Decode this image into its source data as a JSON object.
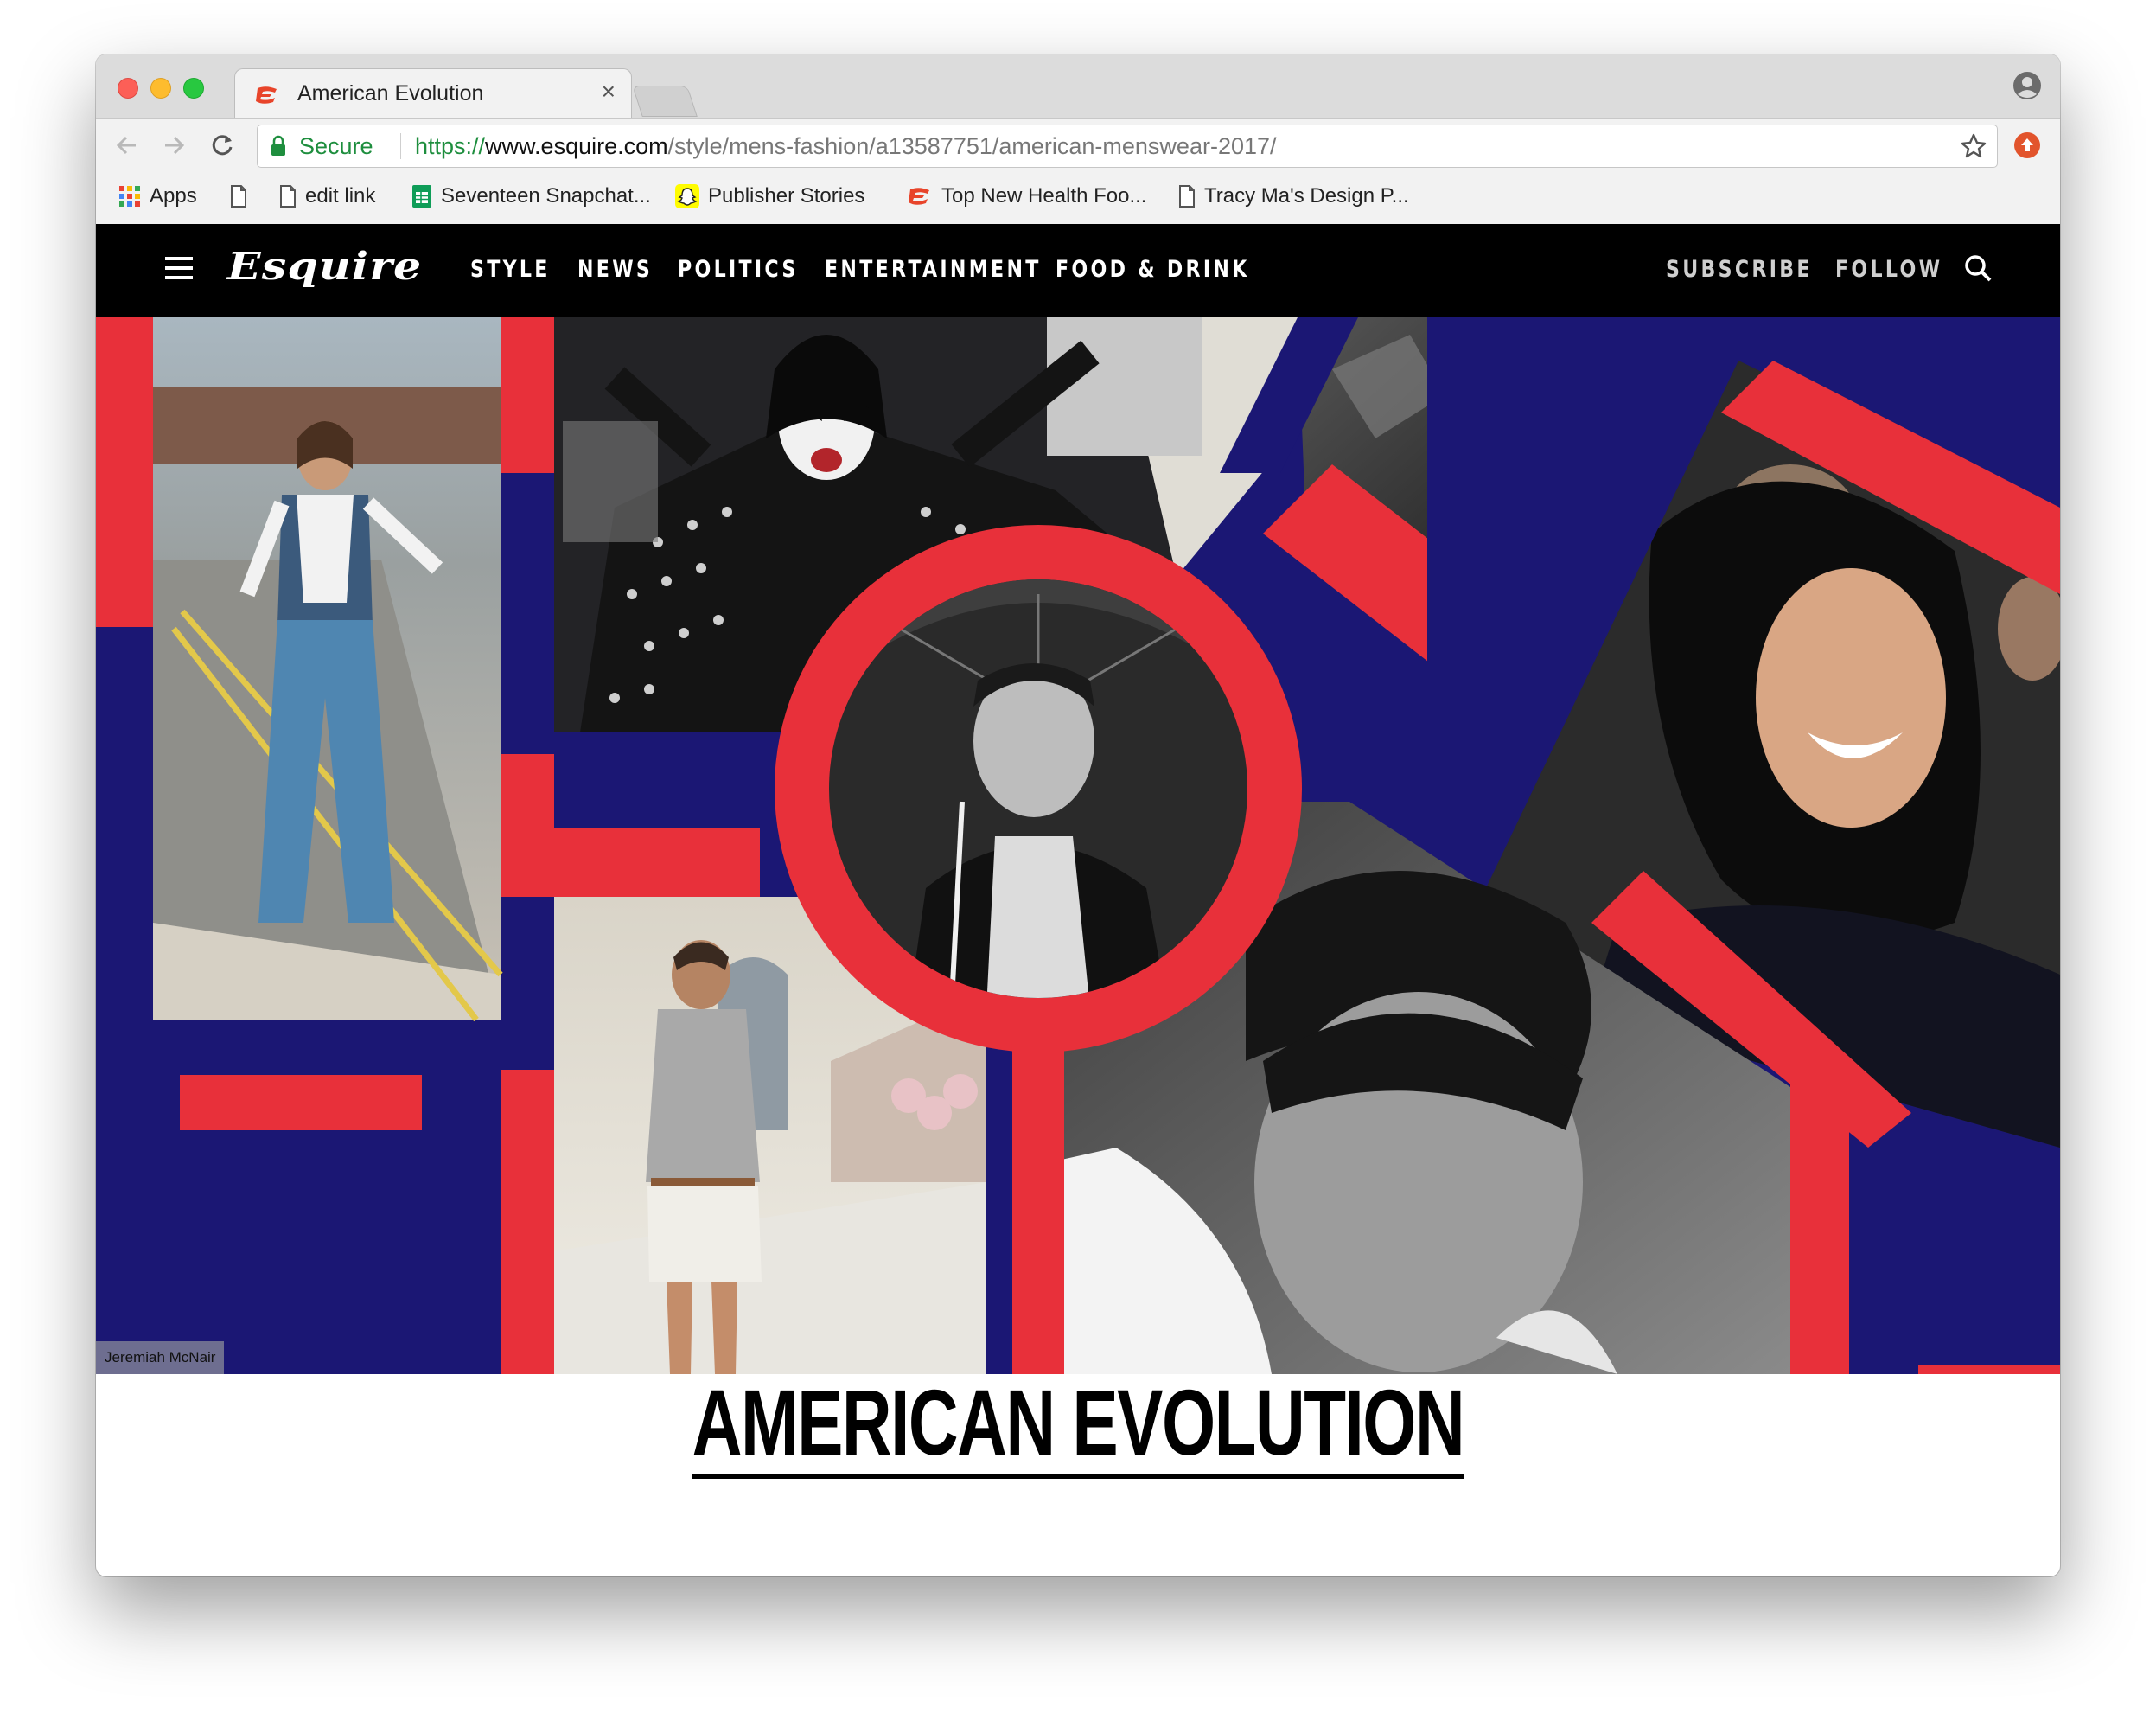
{
  "browser": {
    "tab_title": "American Evolution",
    "tab_close": "×",
    "secure_label": "Secure",
    "url_scheme": "https://",
    "url_host": "www.esquire.com",
    "url_path": "/style/mens-fashion/a13587751/american-menswear-2017/"
  },
  "bookmarks": [
    {
      "label": "Apps",
      "icon": "apps-grid-icon"
    },
    {
      "label": "",
      "icon": "page-icon"
    },
    {
      "label": "edit link",
      "icon": "page-icon"
    },
    {
      "label": "Seventeen Snapchat...",
      "icon": "sheets-icon"
    },
    {
      "label": "Publisher Stories",
      "icon": "snapchat-icon"
    },
    {
      "label": "Top New Health Foo...",
      "icon": "esquire-favicon-icon"
    },
    {
      "label": "Tracy Ma's Design P...",
      "icon": "page-icon"
    }
  ],
  "site_nav": {
    "logo": "Esquire",
    "links": [
      "STYLE",
      "NEWS",
      "POLITICS",
      "ENTERTAINMENT",
      "FOOD & DRINK"
    ],
    "right_links": [
      "SUBSCRIBE",
      "FOLLOW"
    ]
  },
  "hero": {
    "credit": "Jeremiah McNair",
    "colors": {
      "navy": "#1b1774",
      "red": "#e8303a"
    }
  },
  "article": {
    "headline": "AMERICAN EVOLUTION"
  }
}
